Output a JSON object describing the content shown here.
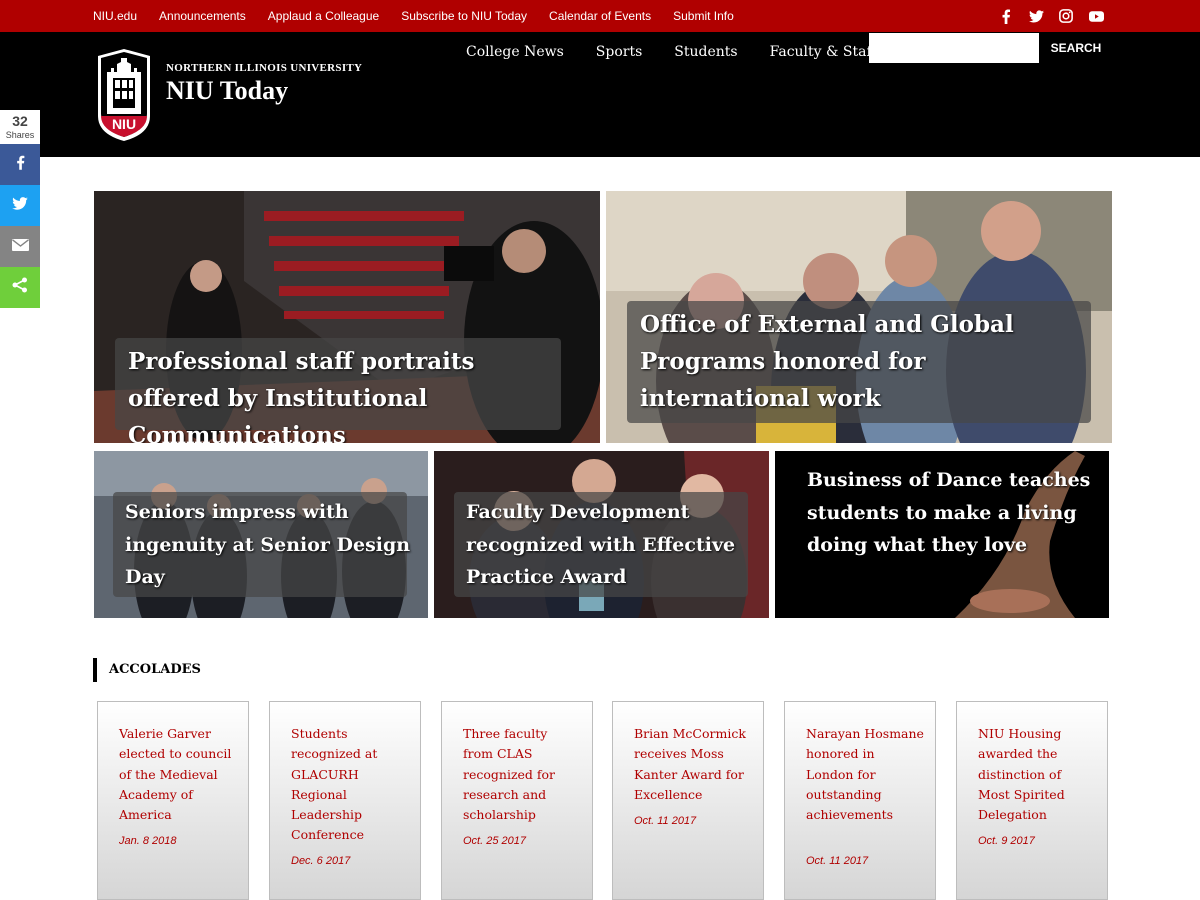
{
  "utility_nav": [
    "NIU.edu",
    "Announcements",
    "Applaud a Colleague",
    "Subscribe to NIU Today",
    "Calendar of Events",
    "Submit Info"
  ],
  "social_icons": [
    "facebook-icon",
    "twitter-icon",
    "instagram-icon",
    "youtube-icon"
  ],
  "header": {
    "university": "NORTHERN ILLINOIS UNIVERSITY",
    "site_title": "NIU Today",
    "logo_text": "NIU"
  },
  "main_nav": [
    "College News",
    "Sports",
    "Students",
    "Faculty & Staff"
  ],
  "search": {
    "placeholder": "",
    "button_label": "SEARCH"
  },
  "share": {
    "count": "32",
    "label": "Shares",
    "buttons": [
      "facebook-icon",
      "twitter-icon",
      "email-icon",
      "share-icon"
    ]
  },
  "features": [
    {
      "title": "Professional staff portraits offered by Institutional Communications"
    },
    {
      "title": "Office of External and Global Programs honored for international work"
    },
    {
      "title": "Seniors impress with ingenuity at Senior Design Day"
    },
    {
      "title": "Faculty Development recognized with Effective Practice Award"
    },
    {
      "title": "Business of Dance teaches students to make a living doing what they love"
    }
  ],
  "accolades": {
    "heading": "ACCOLADES",
    "items": [
      {
        "title": "Valerie Garver elected to council of the Medieval Academy of America",
        "date": "Jan. 8 2018"
      },
      {
        "title": "Students recognized at GLACURH Regional Leadership Conference",
        "date": "Dec. 6 2017"
      },
      {
        "title": "Three faculty from CLAS recognized for research and scholarship",
        "date": "Oct. 25 2017"
      },
      {
        "title": "Brian McCormick receives Moss Kanter Award for Excellence",
        "date": "Oct. 11 2017"
      },
      {
        "title": "Narayan Hosmane honored in London for outstanding achievements",
        "date": "Oct. 11 2017"
      },
      {
        "title": "NIU Housing awarded the distinction of Most Spirited Delegation",
        "date": "Oct. 9 2017"
      }
    ]
  },
  "colors": {
    "brand_red": "#b00000",
    "header_black": "#000000",
    "facebook": "#3b5998",
    "twitter": "#1da1f2",
    "email": "#848484",
    "share": "#6fcf3b"
  }
}
